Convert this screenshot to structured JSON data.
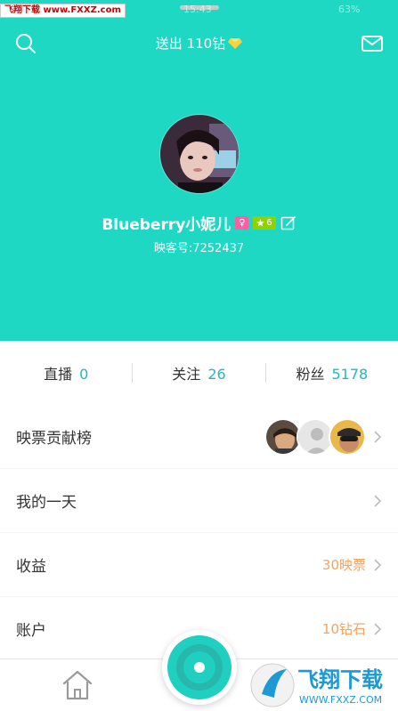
{
  "status_bar": {
    "watermark_text": "飞翔下载 www.FXXZ.com",
    "time_faint": "15:43",
    "right_faint": "63%"
  },
  "header": {
    "title": "送出 110钻",
    "search_icon": "search-icon",
    "mail_icon": "mail-icon",
    "diamond_icon": "diamond-icon"
  },
  "profile": {
    "username": "Blueberry小妮儿",
    "gender_symbol": "♀",
    "level": "6",
    "id_text": "映客号:7252437"
  },
  "stats": [
    {
      "label": "直播",
      "value": "0"
    },
    {
      "label": "关注",
      "value": "26"
    },
    {
      "label": "粉丝",
      "value": "5178"
    }
  ],
  "menu": {
    "contribution": {
      "label": "映票贡献榜"
    },
    "my_day": {
      "label": "我的一天"
    },
    "earnings": {
      "label": "收益",
      "value": "30映票"
    },
    "account": {
      "label": "账户",
      "value": "10钻石"
    }
  },
  "tabbar": {
    "home_icon": "home-icon",
    "record_icon": "live-record-icon"
  },
  "watermark_br": {
    "text": "飞翔下载",
    "url": "WWW.FXXZ.COM"
  },
  "colors": {
    "accent": "#1fd8c4",
    "stat_number": "#1fb8c4",
    "value_orange": "#f5a35a"
  }
}
